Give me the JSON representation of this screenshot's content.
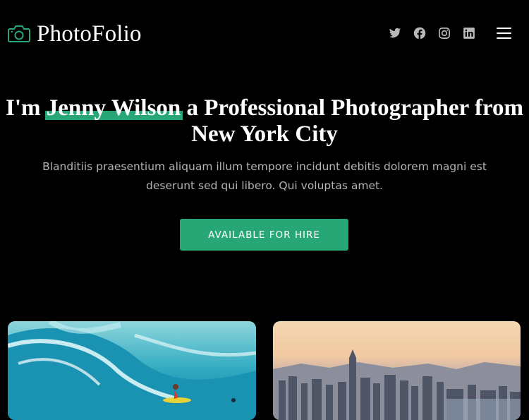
{
  "header": {
    "logo_text": "PhotoFolio",
    "social_icons": [
      "twitter-icon",
      "facebook-icon",
      "instagram-icon",
      "linkedin-icon"
    ],
    "menu_icon": "hamburger-icon"
  },
  "hero": {
    "title_before": "I'm ",
    "title_highlight": "Jenny Wilson",
    "title_after": " a Professional Photographer from New York City",
    "description": "Blanditiis praesentium aliquam illum tempore incidunt debitis dolorem magni est deserunt sed qui libero. Qui voluptas amet.",
    "cta_label": "AVAILABLE FOR HIRE"
  },
  "gallery": [
    {
      "subject": "surfer-riding-wave-photo"
    },
    {
      "subject": "city-skyline-at-sunset-photo"
    }
  ],
  "colors": {
    "accent": "#27a776",
    "background": "#000000",
    "text": "#ffffff",
    "muted_text": "#b4b4b4"
  }
}
